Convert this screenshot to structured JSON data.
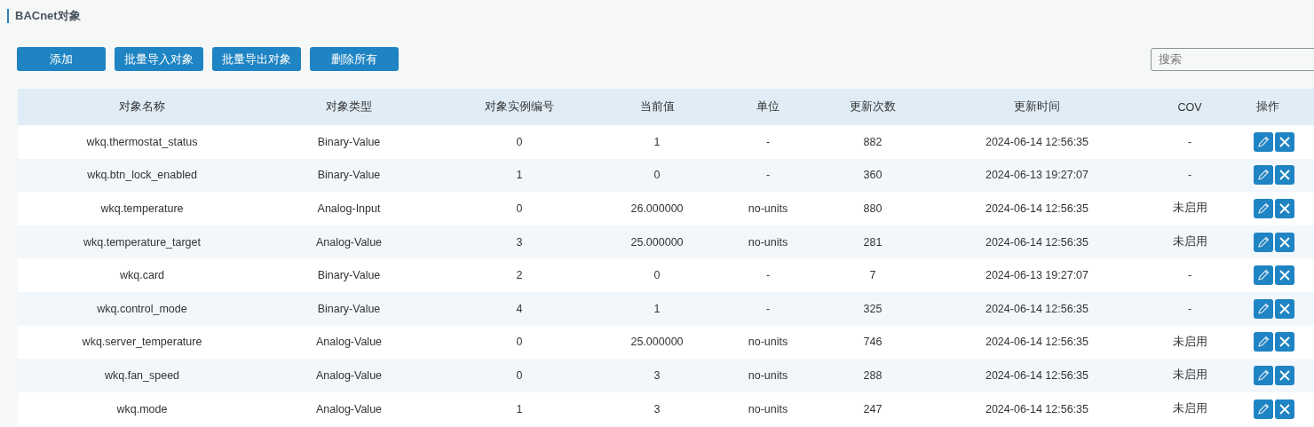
{
  "title": "BACnet对象",
  "buttons": [
    "添加",
    "批量导入对象",
    "批量导出对象",
    "删除所有"
  ],
  "search": {
    "placeholder": "搜索"
  },
  "table": {
    "columns": [
      "对象名称",
      "对象类型",
      "对象实例编号",
      "当前值",
      "单位",
      "更新次数",
      "更新时间",
      "COV",
      "操作"
    ],
    "rows": [
      [
        "wkq.thermostat_status",
        "Binary-Value",
        "0",
        "1",
        "-",
        "882",
        "2024-06-14 12:56:35",
        "-"
      ],
      [
        "wkq.btn_lock_enabled",
        "Binary-Value",
        "1",
        "0",
        "-",
        "360",
        "2024-06-13 19:27:07",
        "-"
      ],
      [
        "wkq.temperature",
        "Analog-Input",
        "0",
        "26.000000",
        "no-units",
        "880",
        "2024-06-14 12:56:35",
        "未启用"
      ],
      [
        "wkq.temperature_target",
        "Analog-Value",
        "3",
        "25.000000",
        "no-units",
        "281",
        "2024-06-14 12:56:35",
        "未启用"
      ],
      [
        "wkq.card",
        "Binary-Value",
        "2",
        "0",
        "-",
        "7",
        "2024-06-13 19:27:07",
        "-"
      ],
      [
        "wkq.control_mode",
        "Binary-Value",
        "4",
        "1",
        "-",
        "325",
        "2024-06-14 12:56:35",
        "-"
      ],
      [
        "wkq.server_temperature",
        "Analog-Value",
        "0",
        "25.000000",
        "no-units",
        "746",
        "2024-06-14 12:56:35",
        "未启用"
      ],
      [
        "wkq.fan_speed",
        "Analog-Value",
        "0",
        "3",
        "no-units",
        "288",
        "2024-06-14 12:56:35",
        "未启用"
      ],
      [
        "wkq.mode",
        "Analog-Value",
        "1",
        "3",
        "no-units",
        "247",
        "2024-06-14 12:56:35",
        "未启用"
      ]
    ]
  }
}
